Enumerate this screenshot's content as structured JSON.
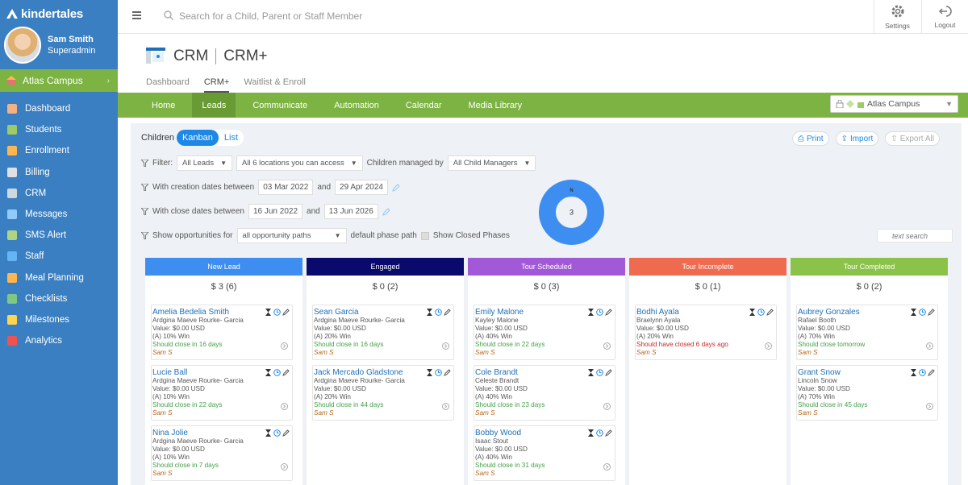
{
  "brand": "kindertales",
  "user": {
    "name": "Sam Smith",
    "role": "Superadmin"
  },
  "campus": "Atlas Campus",
  "nav": [
    {
      "label": "Dashboard",
      "icon": "dashboard-icon",
      "color": "#f4b183"
    },
    {
      "label": "Students",
      "icon": "students-icon",
      "color": "#9ccc65"
    },
    {
      "label": "Enrollment",
      "icon": "enrollment-icon",
      "color": "#ffb74d"
    },
    {
      "label": "Billing",
      "icon": "billing-icon",
      "color": "#e0e0e0"
    },
    {
      "label": "CRM",
      "icon": "crm-icon",
      "color": "#cfd8dc"
    },
    {
      "label": "Messages",
      "icon": "messages-icon",
      "color": "#90caf9"
    },
    {
      "label": "SMS Alert",
      "icon": "sms-icon",
      "color": "#aed581"
    },
    {
      "label": "Staff",
      "icon": "staff-icon",
      "color": "#64b5f6"
    },
    {
      "label": "Meal Planning",
      "icon": "meal-icon",
      "color": "#ffb74d"
    },
    {
      "label": "Checklists",
      "icon": "checklist-icon",
      "color": "#81c784"
    },
    {
      "label": "Milestones",
      "icon": "star-icon",
      "color": "#ffd54f"
    },
    {
      "label": "Analytics",
      "icon": "pie-chart-icon",
      "color": "#ef5350"
    }
  ],
  "search": {
    "placeholder": "Search for a Child, Parent or Staff Member"
  },
  "topbar": {
    "settings": "Settings",
    "logout": "Logout"
  },
  "header": {
    "title": "CRM",
    "subtitle": "CRM+",
    "tabs": [
      "Dashboard",
      "CRM+",
      "Waitlist & Enroll"
    ]
  },
  "menu": [
    "Home",
    "Leads",
    "Communicate",
    "Automation",
    "Calendar",
    "Media Library"
  ],
  "campus_select": "Atlas Campus",
  "view": {
    "label": "Children",
    "kanban": "Kanban",
    "list": "List"
  },
  "actions": {
    "print": "Print",
    "import": "Import",
    "export": "Export All"
  },
  "filters": {
    "filter_label": "Filter:",
    "leads": "All Leads",
    "locations": "All 6 locations you can access",
    "managed_by_label": "Children managed by",
    "managers": "All Child Managers",
    "creation_label": "With creation dates between",
    "creation_from": "03 Mar 2022",
    "and1": "and",
    "creation_to": "29 Apr 2024",
    "close_label": "With close dates between",
    "close_from": "16 Jun 2022",
    "and2": "and",
    "close_to": "13 Jun 2026",
    "opp_label": "Show opportunities for",
    "paths": "all opportunity paths",
    "default_path": "default phase path",
    "show_closed": "Show Closed Phases",
    "text_search_placeholder": "text search"
  },
  "donut": {
    "letter": "N",
    "value": "3",
    "color": "#3d8ef0"
  },
  "columns": [
    {
      "title": "New Lead",
      "color": "#3d8ef0",
      "sum": "$ 3 (6)",
      "cards": [
        {
          "name": "Amelia Bedelia Smith",
          "parent": "Ardgina Maeve Rourke- Garcia",
          "value": "Value: $0.00 USD",
          "win": "(A) 10% Win",
          "close": "Should close in 16 days",
          "owner": "Sam S",
          "overdue": false
        },
        {
          "name": "Lucie Ball",
          "parent": "Ardgina Maeve Rourke- Garcia",
          "value": "Value: $0.00 USD",
          "win": "(A) 10% Win",
          "close": "Should close in 22 days",
          "owner": "Sam S",
          "overdue": false
        },
        {
          "name": "Nina Jolie",
          "parent": "Ardgina Maeve Rourke- Garcia",
          "value": "Value: $0.00 USD",
          "win": "(A) 10% Win",
          "close": "Should close in 7 days",
          "owner": "Sam S",
          "overdue": false
        }
      ]
    },
    {
      "title": "Engaged",
      "color": "#0a0a6e",
      "sum": "$ 0 (2)",
      "cards": [
        {
          "name": "Sean Garcia",
          "parent": "Ardgina Maeve Rourke- Garcia",
          "value": "Value: $0.00 USD",
          "win": "(A) 20% Win",
          "close": "Should close in 16 days",
          "owner": "Sam S",
          "overdue": false
        },
        {
          "name": "Jack Mercado Gladstone",
          "parent": "Ardgina Maeve Rourke- Garcia",
          "value": "Value: $0.00 USD",
          "win": "(A) 20% Win",
          "close": "Should close in 44 days",
          "owner": "Sam S",
          "overdue": false
        }
      ]
    },
    {
      "title": "Tour Scheduled",
      "color": "#a259d8",
      "sum": "$ 0 (3)",
      "cards": [
        {
          "name": "Emily Malone",
          "parent": "Kayley Malone",
          "value": "Value: $0.00 USD",
          "win": "(A) 40% Win",
          "close": "Should close in 22 days",
          "owner": "Sam S",
          "overdue": false
        },
        {
          "name": "Cole Brandt",
          "parent": "Celeste Brandt",
          "value": "Value: $0.00 USD",
          "win": "(A) 40% Win",
          "close": "Should close in 23 days",
          "owner": "Sam S",
          "overdue": false
        },
        {
          "name": "Bobby Wood",
          "parent": "Isaac Stout",
          "value": "Value: $0.00 USD",
          "win": "(A) 40% Win",
          "close": "Should close in 31 days",
          "owner": "Sam S",
          "overdue": false
        }
      ]
    },
    {
      "title": "Tour Incomplete",
      "color": "#ef6b50",
      "sum": "$ 0 (1)",
      "cards": [
        {
          "name": "Bodhi Ayala",
          "parent": "Braelynn Ayala",
          "value": "Value: $0.00 USD",
          "win": "(A) 20% Win",
          "close": "Should have closed 6 days ago",
          "owner": "Sam S",
          "overdue": true
        }
      ]
    },
    {
      "title": "Tour Completed",
      "color": "#8bc34a",
      "sum": "$ 0 (2)",
      "cards": [
        {
          "name": "Aubrey Gonzales",
          "parent": "Rafael Booth",
          "value": "Value: $0.00 USD",
          "win": "(A) 70% Win",
          "close": "Should close tomorrow",
          "owner": "Sam S",
          "overdue": false
        },
        {
          "name": "Grant Snow",
          "parent": "Lincoln Snow",
          "value": "Value: $0.00 USD",
          "win": "(A) 70% Win",
          "close": "Should close in 45 days",
          "owner": "Sam S",
          "overdue": false
        }
      ]
    }
  ]
}
